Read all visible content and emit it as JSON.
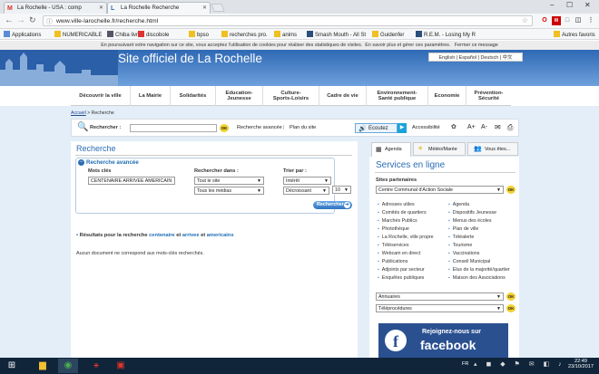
{
  "browser": {
    "tabs": [
      {
        "label": "La Rochelle - USA : comp",
        "favicon": "M"
      },
      {
        "label": "La Rochelle Recherche",
        "favicon": "L"
      }
    ],
    "url": "www.ville-larochelle.fr/recherche.html",
    "bookmarks": [
      "Applications",
      "NUMERICABLE",
      "Chiba livré",
      "discobole",
      "bpso",
      "recherches pro.",
      "anims",
      "Smash Mouth - All St",
      "Guidenfer",
      "R.E.M. - Losing My R"
    ],
    "other_bookmarks": "Autres favoris"
  },
  "cookie_notice": {
    "text": "En poursuivant votre navigation sur ce site, vous acceptez l'utilisation de cookies pour réaliser des statistiques de visites.",
    "more": "En savoir plus et gérer ces paramètres.",
    "close": "Fermer ce message"
  },
  "site": {
    "title": "Site officiel de La Rochelle",
    "languages": [
      "English",
      "Español",
      "Deutsch",
      "中文"
    ]
  },
  "menu": [
    [
      "Découvrir la ville"
    ],
    [
      "La Mairie"
    ],
    [
      "Solidarités"
    ],
    [
      "Education-",
      "Jeunesse"
    ],
    [
      "Culture-",
      "Sports-Loisirs"
    ],
    [
      "Cadre de vie"
    ],
    [
      "Environnement-",
      "Santé publique"
    ],
    [
      "Economie"
    ],
    [
      "Prévention-",
      "Sécurité"
    ]
  ],
  "breadcrumb": {
    "home": "Accueil",
    "sep": ">",
    "current": "Recherche"
  },
  "toolbar": {
    "search_label": "Rechercher :",
    "ok": "OK",
    "advanced": "Recherche avancée",
    "sitemap": "Plan du site",
    "listen": "Ecoutez",
    "accessibility": "Accessibilité",
    "font_a_plus": "A+",
    "font_a_minus": "A-"
  },
  "search": {
    "title": "Recherche",
    "advanced_title": "Recherche avancée",
    "keywords_label": "Mots clés",
    "keywords_value": "CENTENAIRE ARRIVEE AMERICAIN",
    "search_in_label": "Rechercher dans :",
    "search_in_value": "Tout le site",
    "media_value": "Tous les médias",
    "sort_label": "Trier par :",
    "sort_value": "Intérêt",
    "order_value": "Décroissant",
    "count_value": "10",
    "submit": "Rechercher",
    "results_prefix": "Résultats pour la recherche",
    "terms": [
      "centenaire",
      "arrivee",
      "americains"
    ],
    "and": "et",
    "no_results": "Aucun document ne correspond aux mots-clés recherchés."
  },
  "sidebar": {
    "tabs": [
      "Agenda",
      "Météo/Marée",
      "Vous êtes..."
    ],
    "title": "Services en ligne",
    "partners_label": "Sites partenaires",
    "partners_value": "Centre Communal d'Action Sociale",
    "left_links": [
      "Adresses utiles",
      "Comités de quartiers",
      "Marchés Publics",
      "Photothèque",
      "La Rochelle, ville propre",
      "Téléservices",
      "Webcam en direct",
      "Publications",
      "Adjoints par secteur",
      "Enquêtes publiques"
    ],
    "right_links": [
      "Agenda",
      "Dispositifs Jeunesse",
      "Menus des écoles",
      "Plan de ville",
      "Téléalerte",
      "Tourisme",
      "Vaccinations",
      "Conseil Municipal",
      "Elus de la majorité/quartier",
      "Maison des Associations"
    ],
    "annuaires": "Annuaires",
    "teleprocedures": "Téléprocédures",
    "facebook_join": "Rejoignez-nous sur",
    "facebook": "facebook"
  },
  "taskbar": {
    "lang": "FR",
    "time": "22:49",
    "date": "23/10/2017"
  }
}
